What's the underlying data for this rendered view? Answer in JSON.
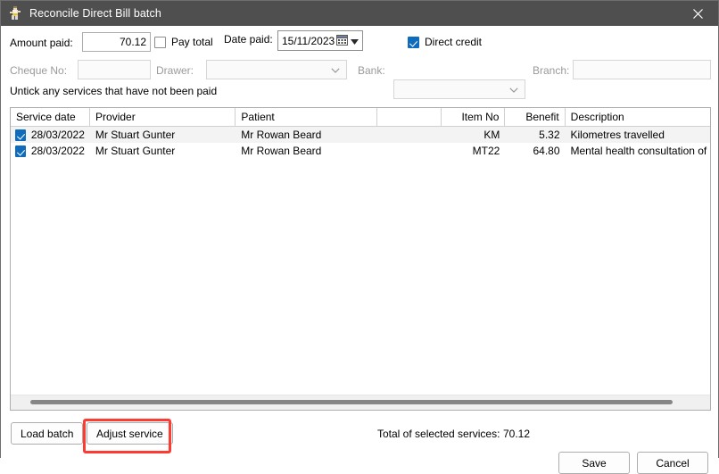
{
  "window": {
    "title": "Reconcile Direct Bill batch",
    "icon": "person-figure-icon",
    "close_label": "✕"
  },
  "form": {
    "amount_label": "Amount paid:",
    "amount_value": "70.12",
    "pay_total_label": "Pay total",
    "pay_total_checked": false,
    "date_paid_label": "Date paid:",
    "date_paid_value": "15/11/2023",
    "direct_credit_label": "Direct credit",
    "direct_credit_checked": true,
    "cheque_no_label": "Cheque No:",
    "cheque_no_value": "",
    "drawer_label": "Drawer:",
    "drawer_value": "",
    "bank_label": "Bank:",
    "bank_value": "",
    "branch_label": "Branch:",
    "branch_value": ""
  },
  "hint": "Untick any services that have not been paid",
  "grid": {
    "columns": [
      {
        "label": "Service date",
        "align": "left"
      },
      {
        "label": "Provider",
        "align": "left"
      },
      {
        "label": "Patient",
        "align": "left"
      },
      {
        "label": "",
        "align": "left"
      },
      {
        "label": "Item No",
        "align": "right"
      },
      {
        "label": "Benefit",
        "align": "right"
      },
      {
        "label": "Description",
        "align": "left"
      }
    ],
    "rows": [
      {
        "checked": true,
        "service_date": "28/03/2022",
        "provider": "Mr Stuart Gunter",
        "patient": "Mr Rowan Beard",
        "blank": "",
        "item_no": "KM",
        "benefit": "5.32",
        "description": "Kilometres travelled"
      },
      {
        "checked": true,
        "service_date": "28/03/2022",
        "provider": "Mr Stuart Gunter",
        "patient": "Mr Rowan Beard",
        "blank": "",
        "item_no": "MT22",
        "benefit": "64.80",
        "description": "Mental health consultation of at least"
      }
    ]
  },
  "footer": {
    "load_batch_label": "Load batch",
    "adjust_service_label": "Adjust service",
    "total_label": "Total of selected services:",
    "total_value": "70.12",
    "save_label": "Save",
    "cancel_label": "Cancel"
  },
  "colors": {
    "titlebar": "#4f4f4f",
    "accent_checkbox": "#0f6cbd",
    "highlight": "#fc3b33",
    "alt_row": "#f3f3f3"
  }
}
